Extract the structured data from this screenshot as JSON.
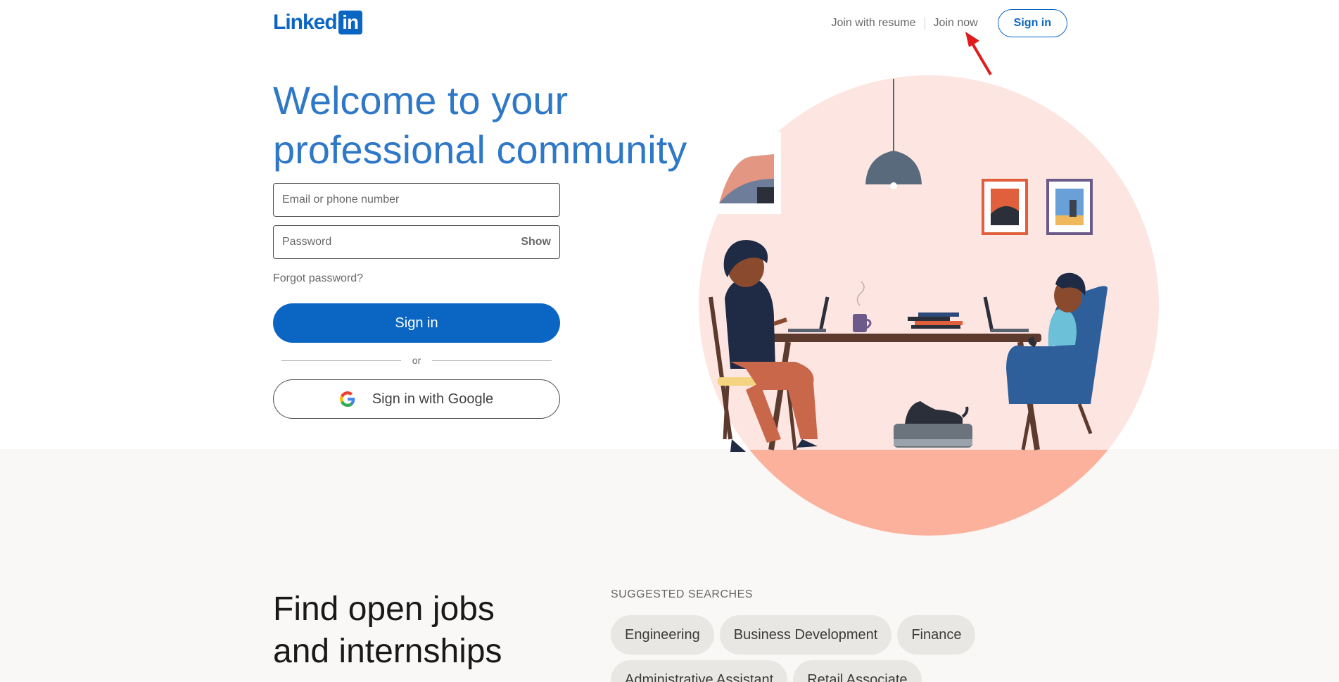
{
  "header": {
    "logo_text": "Linked",
    "logo_box": "in",
    "join_resume": "Join with resume",
    "join_now": "Join now",
    "sign_in": "Sign in"
  },
  "hero": {
    "title": "Welcome to your professional community"
  },
  "form": {
    "email_placeholder": "Email or phone number",
    "password_placeholder": "Password",
    "show_label": "Show",
    "forgot_label": "Forgot password?",
    "sign_in_label": "Sign in",
    "or_label": "or",
    "google_label": "Sign in with Google"
  },
  "jobs": {
    "title": "Find open jobs and internships",
    "suggested_label": "SUGGESTED SEARCHES",
    "pills": [
      "Engineering",
      "Business Development",
      "Finance",
      "Administrative Assistant",
      "Retail Associate"
    ]
  },
  "colors": {
    "brand": "#0a66c2",
    "hero_title": "#2e78c7",
    "annotation_arrow": "#e11b1b"
  }
}
